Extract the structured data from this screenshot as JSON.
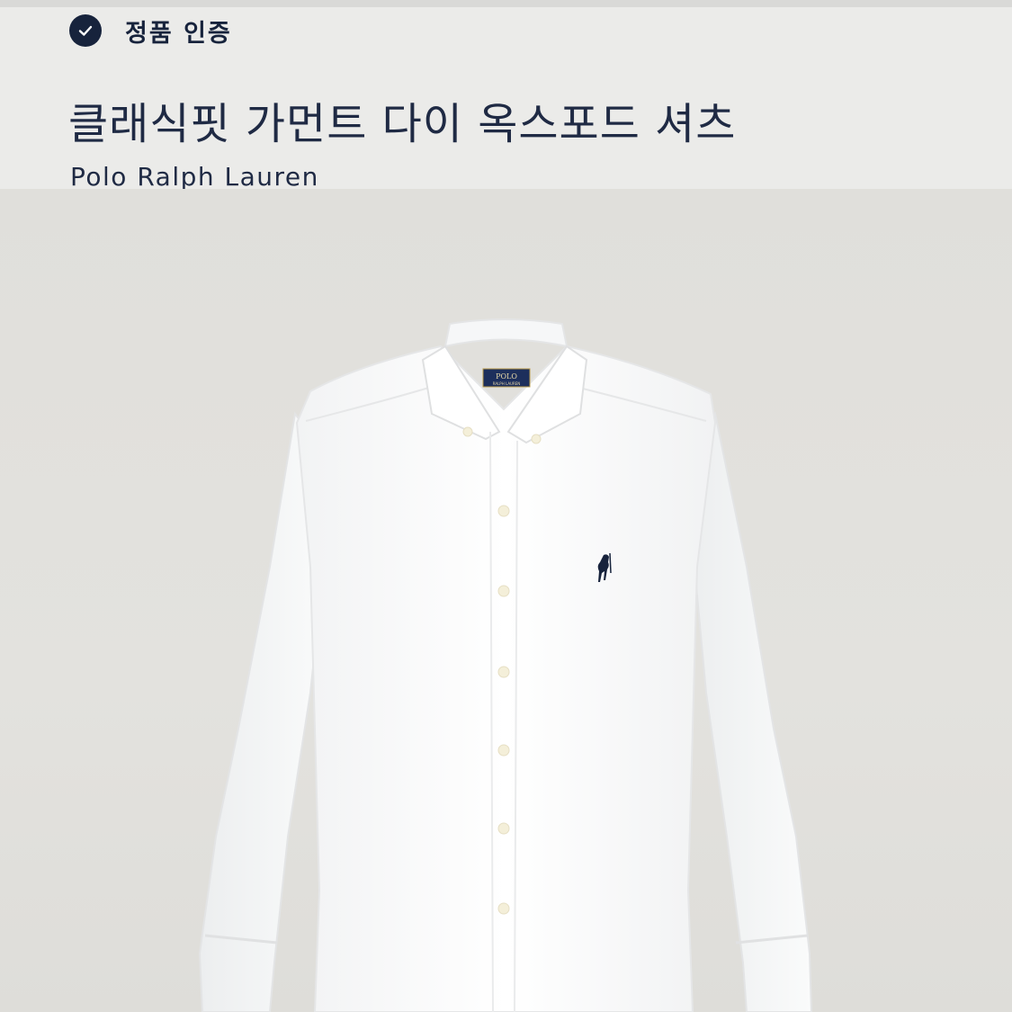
{
  "authenticity": {
    "label": "정품 인증",
    "icon": "check-circle-icon"
  },
  "product": {
    "title": "클래식핏 가먼트 다이 옥스포드 셔츠",
    "brand": "Polo Ralph Lauren"
  },
  "image": {
    "subject": "white-oxford-shirt",
    "label_text": "POLO",
    "accent_color": "#17233c",
    "background_color": "#e2e1dd"
  }
}
